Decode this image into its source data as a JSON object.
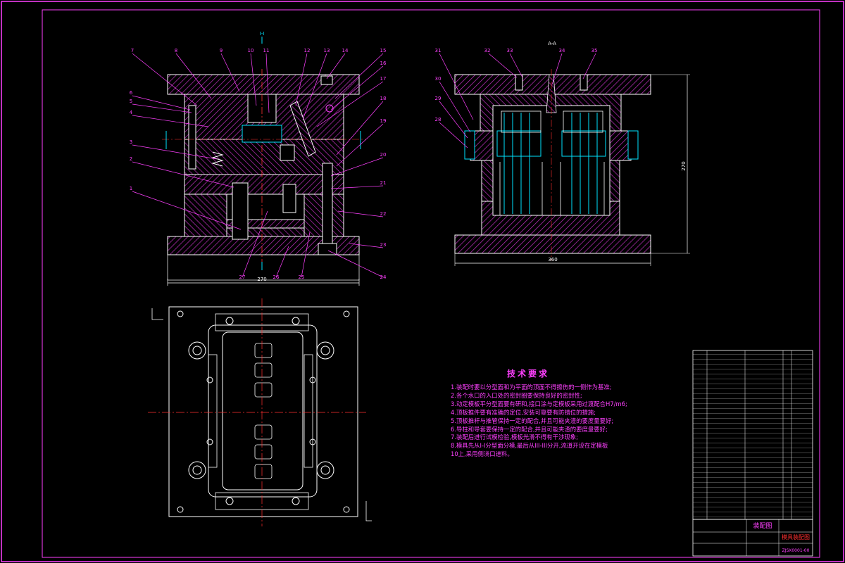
{
  "drawing": {
    "section_mark_left": "I-I",
    "section_mark_right": "A-A",
    "tech_requirements": {
      "title": "技术要求",
      "items": [
        "1.装配时要以分型面和为平面的顶面不得擦伤的一侧作为基准;",
        "2.各个水口的入口处的密封圈要保持良好的密封性;",
        "3.动定模板平分型面要有研和,接口涂与定模板采用过渡配合H7/m6;",
        "4.顶板推件要有准确的定位,安装可靠要有防错位的措施;",
        "5.顶板推杆与推管保持一定的配合,并且可能夹渣的要度量要好;",
        "6.导柱和导套要保持一定的配合,并且可能夹渣的要度量要好;",
        "7.装配后进行试模检验,模板光滑不得有干涉现象;",
        "8.模具先从I-I分型面分模,最后从III-III分开,流道开设在定模板",
        "10上,采用侧浇口进料。"
      ]
    },
    "dimensions": {
      "left_width": "270",
      "right_width": "360",
      "right_height": "270"
    },
    "left_callouts": [
      "7",
      "8",
      "9",
      "10",
      "11",
      "12",
      "13",
      "14",
      "15",
      "16",
      "17",
      "18",
      "19",
      "20",
      "21",
      "22",
      "23",
      "24",
      "25",
      "26",
      "27",
      "1",
      "2",
      "3",
      "4",
      "5",
      "6"
    ],
    "right_callouts": [
      "31",
      "32",
      "33",
      "34",
      "35",
      "30",
      "29",
      "28"
    ],
    "title_block": {
      "drawing_name": "装配图",
      "title_text": "模具装配图",
      "drawing_number": "ZJSX0001-00"
    }
  },
  "colors": {
    "background": "#000000",
    "frame": "#ff40ff",
    "outline": "#ffffff",
    "hatch": "#ff40ff",
    "centerline": "#ff3030",
    "cooling": "#00e5ff",
    "dimension": "#ffffff",
    "title_red": "#ff3030"
  }
}
